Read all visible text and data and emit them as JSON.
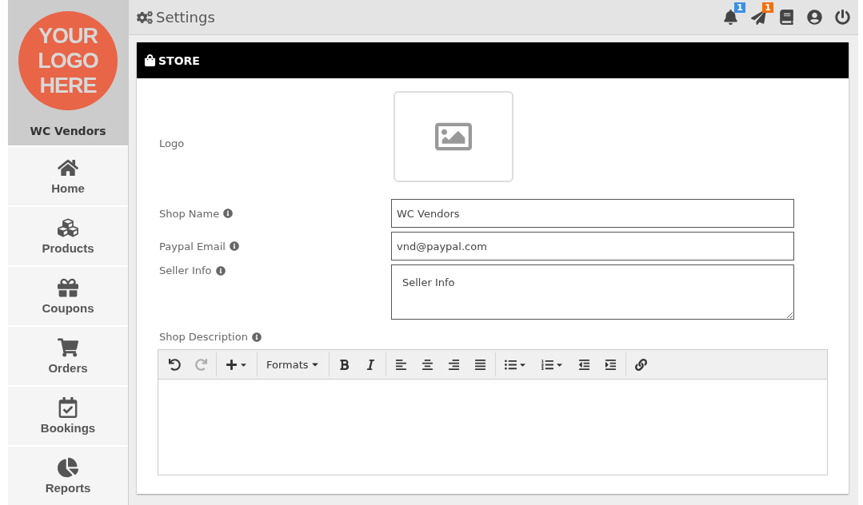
{
  "brand": {
    "logo_text": "YOUR LOGO HERE",
    "name": "WC Vendors"
  },
  "sidebar": {
    "items": [
      {
        "kind": "home",
        "label": "Home",
        "selected": false
      },
      {
        "kind": "products",
        "label": "Products",
        "selected": false
      },
      {
        "kind": "coupons",
        "label": "Coupons",
        "selected": false
      },
      {
        "kind": "orders",
        "label": "Orders",
        "selected": false
      },
      {
        "kind": "bookings",
        "label": "Bookings",
        "selected": false
      },
      {
        "kind": "reports",
        "label": "Reports",
        "selected": false
      }
    ]
  },
  "topbar": {
    "title": "Settings",
    "icons": [
      {
        "kind": "notifications",
        "badge": "1",
        "color": "#3d8fe0"
      },
      {
        "kind": "messages",
        "badge": "1",
        "color": "#f07010"
      },
      {
        "kind": "book"
      },
      {
        "kind": "profile"
      },
      {
        "kind": "power"
      }
    ]
  },
  "panel": {
    "title": "STORE",
    "logo_label": "Logo",
    "fields": [
      {
        "kind": "input",
        "label": "Shop Name",
        "value": "WC Vendors"
      },
      {
        "kind": "input",
        "label": "Paypal Email",
        "value": "vnd@paypal.com"
      },
      {
        "kind": "textarea",
        "label": "Seller Info",
        "placeholder": "Seller Info"
      }
    ],
    "description": {
      "label": "Shop Description",
      "toolbar": [
        {
          "kind": "undo",
          "disabled": false
        },
        {
          "kind": "redo",
          "disabled": true
        },
        {
          "kind": "sep"
        },
        {
          "kind": "insert",
          "disabled": false
        },
        {
          "kind": "sep"
        },
        {
          "kind": "formats",
          "label": "Formats",
          "disabled": false
        },
        {
          "kind": "sep"
        },
        {
          "kind": "bold",
          "disabled": false
        },
        {
          "kind": "italic",
          "disabled": false
        },
        {
          "kind": "sep"
        },
        {
          "kind": "align-left",
          "disabled": false
        },
        {
          "kind": "align-center",
          "disabled": false
        },
        {
          "kind": "align-right",
          "disabled": false
        },
        {
          "kind": "justify",
          "disabled": false
        },
        {
          "kind": "sep"
        },
        {
          "kind": "bullet-list",
          "disabled": false
        },
        {
          "kind": "numbered-list",
          "disabled": false
        },
        {
          "kind": "outdent",
          "disabled": false
        },
        {
          "kind": "indent",
          "disabled": false
        },
        {
          "kind": "sep"
        },
        {
          "kind": "link",
          "disabled": false
        }
      ]
    }
  }
}
